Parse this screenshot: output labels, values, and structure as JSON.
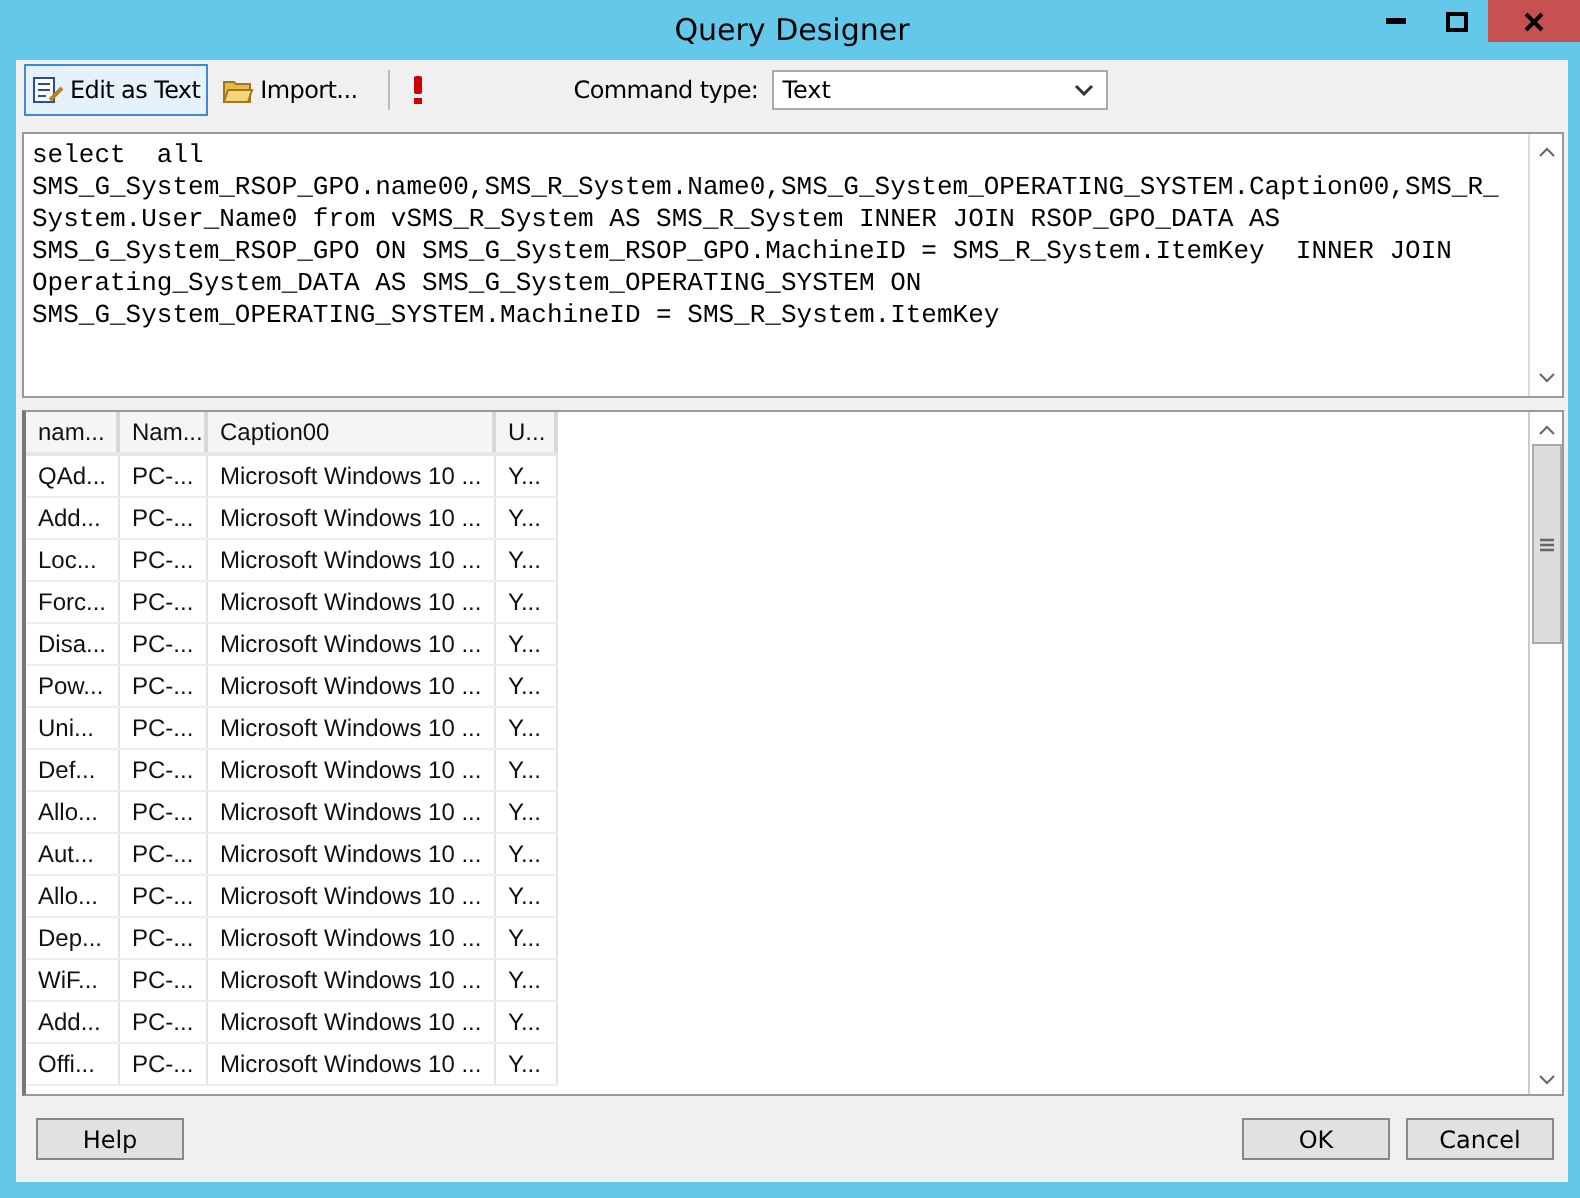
{
  "window": {
    "title": "Query Designer"
  },
  "toolbar": {
    "buttons": [
      {
        "label": "Edit as Text",
        "kind": "edit",
        "selected": true
      },
      {
        "label": "Import...",
        "kind": "import",
        "selected": false
      }
    ],
    "command_type": {
      "label": "Command type:",
      "value": "Text"
    }
  },
  "query": "select  all\nSMS_G_System_RSOP_GPO.name00,SMS_R_System.Name0,SMS_G_System_OPERATING_SYSTEM.Caption00,SMS_R_\nSystem.User_Name0 from vSMS_R_System AS SMS_R_System INNER JOIN RSOP_GPO_DATA AS\nSMS_G_System_RSOP_GPO ON SMS_G_System_RSOP_GPO.MachineID = SMS_R_System.ItemKey  INNER JOIN\nOperating_System_DATA AS SMS_G_System_OPERATING_SYSTEM ON\nSMS_G_System_OPERATING_SYSTEM.MachineID = SMS_R_System.ItemKey",
  "table": {
    "columns": [
      "nam...",
      "Nam...",
      "Caption00",
      "U..."
    ],
    "rows": [
      [
        "QAd...",
        "PC-...",
        "Microsoft Windows 10 ...",
        "Y..."
      ],
      [
        "Add...",
        "PC-...",
        "Microsoft Windows 10 ...",
        "Y..."
      ],
      [
        "Loc...",
        "PC-...",
        "Microsoft Windows 10 ...",
        "Y..."
      ],
      [
        "Forc...",
        "PC-...",
        "Microsoft Windows 10 ...",
        "Y..."
      ],
      [
        "Disa...",
        "PC-...",
        "Microsoft Windows 10 ...",
        "Y..."
      ],
      [
        "Pow...",
        "PC-...",
        "Microsoft Windows 10 ...",
        "Y..."
      ],
      [
        "Uni...",
        "PC-...",
        "Microsoft Windows 10 ...",
        "Y..."
      ],
      [
        "Def...",
        "PC-...",
        "Microsoft Windows 10 ...",
        "Y..."
      ],
      [
        "Allo...",
        "PC-...",
        "Microsoft Windows 10 ...",
        "Y..."
      ],
      [
        "Aut...",
        "PC-...",
        "Microsoft Windows 10 ...",
        "Y..."
      ],
      [
        "Allo...",
        "PC-...",
        "Microsoft Windows 10 ...",
        "Y..."
      ],
      [
        "Dep...",
        "PC-...",
        "Microsoft Windows 10 ...",
        "Y..."
      ],
      [
        "WiF...",
        "PC-...",
        "Microsoft Windows 10 ...",
        "Y..."
      ],
      [
        "Add...",
        "PC-...",
        "Microsoft Windows 10 ...",
        "Y..."
      ],
      [
        "Offi...",
        "PC-...",
        "Microsoft Windows 10 ...",
        "Y..."
      ]
    ]
  },
  "footer": {
    "help": "Help",
    "ok": "OK",
    "cancel": "Cancel"
  }
}
